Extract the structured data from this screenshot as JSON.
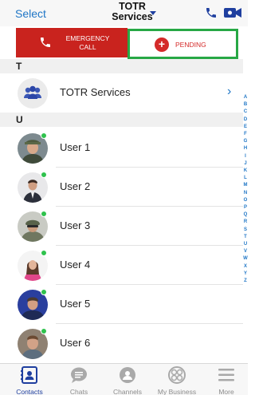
{
  "header": {
    "select_label": "Select",
    "title_line1": "TOTR",
    "title_line2": "Services"
  },
  "actions": {
    "emergency_line1": "EMERGENCY",
    "emergency_line2": "CALL",
    "pending_label": "PENDING"
  },
  "sections": [
    {
      "letter": "T"
    },
    {
      "letter": "U"
    }
  ],
  "group": {
    "name": "TOTR Services"
  },
  "contacts": [
    {
      "name": "User 1",
      "online": true
    },
    {
      "name": "User 2",
      "online": true
    },
    {
      "name": "User 3",
      "online": true
    },
    {
      "name": "User 4",
      "online": true
    },
    {
      "name": "User 5",
      "online": true
    },
    {
      "name": "User 6",
      "online": true
    }
  ],
  "index_letters": [
    "A",
    "B",
    "C",
    "D",
    "E",
    "F",
    "G",
    "H",
    "I",
    "J",
    "K",
    "L",
    "M",
    "N",
    "O",
    "P",
    "Q",
    "R",
    "S",
    "T",
    "U",
    "V",
    "W",
    "X",
    "Y",
    "Z"
  ],
  "tabs": [
    {
      "label": "Contacts",
      "icon": "contacts-icon",
      "active": true
    },
    {
      "label": "Chats",
      "icon": "chats-icon",
      "active": false
    },
    {
      "label": "Channels",
      "icon": "channels-icon",
      "active": false
    },
    {
      "label": "My Business",
      "icon": "my-business-icon",
      "active": false
    },
    {
      "label": "More",
      "icon": "menu-icon",
      "active": false
    }
  ],
  "colors": {
    "accent": "#1f76c6",
    "emergency": "#c9231e",
    "pending_border": "#27a845",
    "online": "#2fc24d"
  }
}
